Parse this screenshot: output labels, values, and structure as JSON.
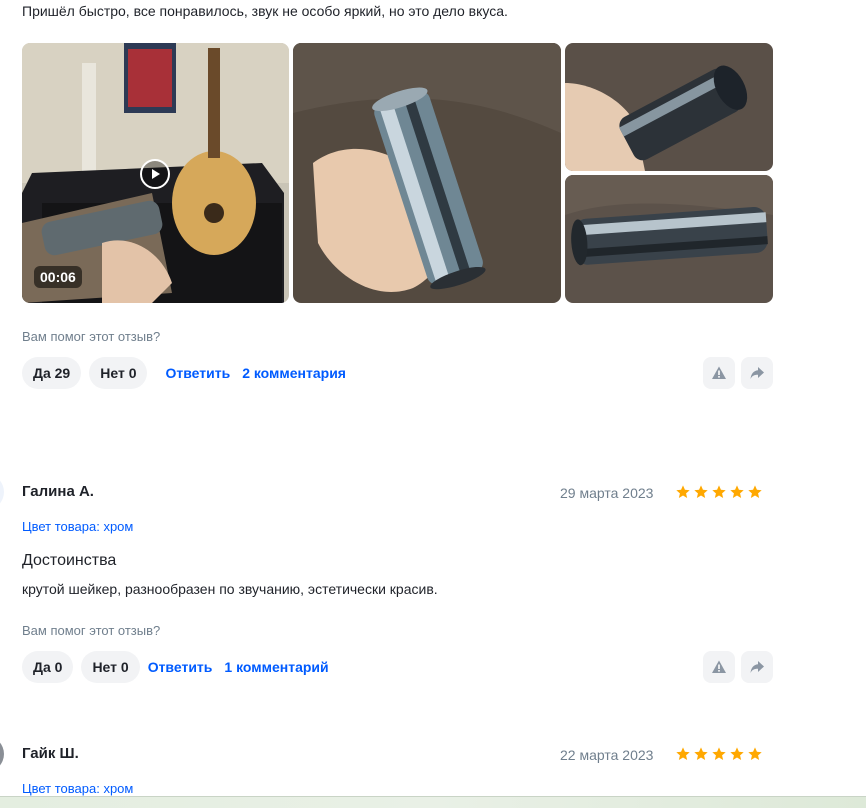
{
  "review1": {
    "text": "Пришёл быстро, все понравилось, звук не особо яркий, но это дело вкуса.",
    "video_duration": "00:06",
    "helpful_question": "Вам помог этот отзыв?",
    "yes_label": "Да 29",
    "no_label": "Нет 0",
    "reply_label": "Ответить",
    "comments_label": "2 комментария"
  },
  "review2": {
    "author": "Галина А.",
    "date": "29 марта 2023",
    "rating": 5,
    "variant": "Цвет товара: хром",
    "section_title": "Достоинства",
    "body": "крутой шейкер, разнообразен по звучанию, эстетически красив.",
    "helpful_question": "Вам помог этот отзыв?",
    "yes_label": "Да 0",
    "no_label": "Нет 0",
    "reply_label": "Ответить",
    "comments_label": "1 комментарий"
  },
  "review3": {
    "author": "Гайк Ш.",
    "date": "22 марта 2023",
    "rating": 5,
    "variant": "Цвет товара: хром"
  },
  "icons": {
    "play": "play-icon",
    "report": "warning-icon",
    "share": "share-icon",
    "star": "star-icon"
  },
  "colors": {
    "link": "#005bff",
    "star": "#ffa800",
    "muted": "#707f8d",
    "button_bg": "#f2f3f5"
  }
}
